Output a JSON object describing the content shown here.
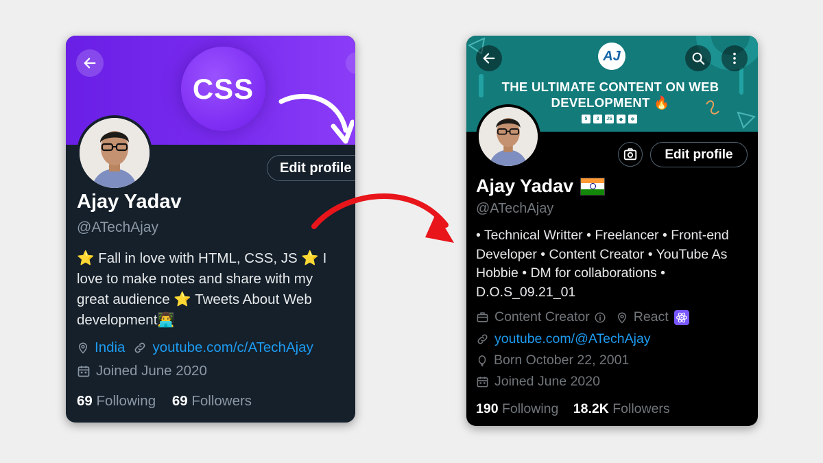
{
  "colors": {
    "background": "#efefef",
    "left_card_bg": "#15202b",
    "left_banner": "#7a2cf0",
    "right_card_bg": "#000000",
    "right_banner": "#147b7b",
    "link": "#1d9bf0",
    "connector_arrow": "#e8151b"
  },
  "left_profile": {
    "banner_badge": "CSS",
    "edit_button": "Edit profile",
    "name": "Ajay Yadav",
    "handle": "@ATechAjay",
    "bio": "⭐ Fall in love with HTML, CSS, JS ⭐ I love to make notes and share with my great audience ⭐ Tweets About Web development👨‍💻",
    "location": "India",
    "website": "youtube.com/c/ATechAjay",
    "joined": "Joined June 2020",
    "following_count": "69",
    "following_label": "Following",
    "followers_count": "69",
    "followers_label": "Followers",
    "icons": [
      "back-arrow-icon",
      "location-pin-icon",
      "link-icon",
      "calendar-icon"
    ]
  },
  "right_profile": {
    "banner_logo": "AJ",
    "banner_headline": "THE ULTIMATE CONTENT ON WEB DEVELOPMENT 🔥",
    "banner_tech_icons": [
      "5",
      "3",
      "JS",
      "◆",
      "⚛"
    ],
    "edit_button": "Edit profile",
    "name": "Ajay Yadav",
    "flag": "india-flag",
    "handle": "@ATechAjay",
    "bio": "• Technical Writter • Freelancer • Front-end Developer • Content Creator • YouTube As Hobbie • DM for collaborations • D.O.S_09.21_01",
    "category": "Content Creator",
    "location": "React",
    "website": "youtube.com/@ATechAjay",
    "born": "Born October 22, 2001",
    "joined": "Joined June 2020",
    "following_count": "190",
    "following_label": "Following",
    "followers_count": "18.2K",
    "followers_label": "Followers",
    "icons": [
      "back-arrow-icon",
      "search-icon",
      "more-vertical-icon",
      "camera-icon",
      "briefcase-icon",
      "info-icon",
      "location-pin-icon",
      "react-atom-icon",
      "link-icon",
      "balloon-icon",
      "calendar-icon"
    ]
  }
}
